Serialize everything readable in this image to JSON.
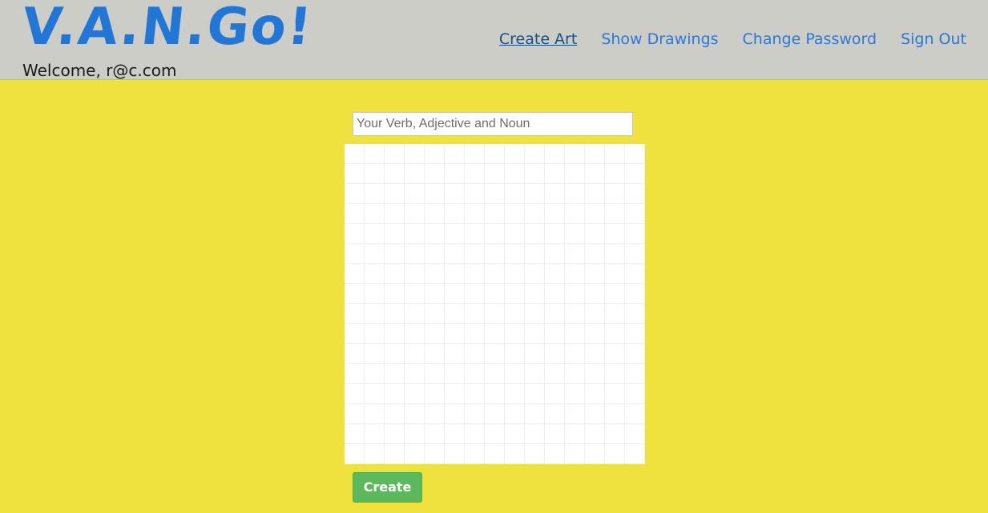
{
  "header": {
    "logo": "V.A.N.Go!",
    "welcome": "Welcome, r@c.com",
    "nav": {
      "create_art": "Create Art",
      "show_drawings": "Show Drawings",
      "change_password": "Change Password",
      "sign_out": "Sign Out"
    }
  },
  "main": {
    "title_input": {
      "value": "",
      "placeholder": "Your Verb, Adjective and Noun"
    },
    "create_button": "Create"
  },
  "colors": {
    "background": "#efe23f",
    "header_background": "#cdcdc8",
    "link": "#2a78d6",
    "active_link": "#164f8a",
    "button": "#5cb85c"
  }
}
